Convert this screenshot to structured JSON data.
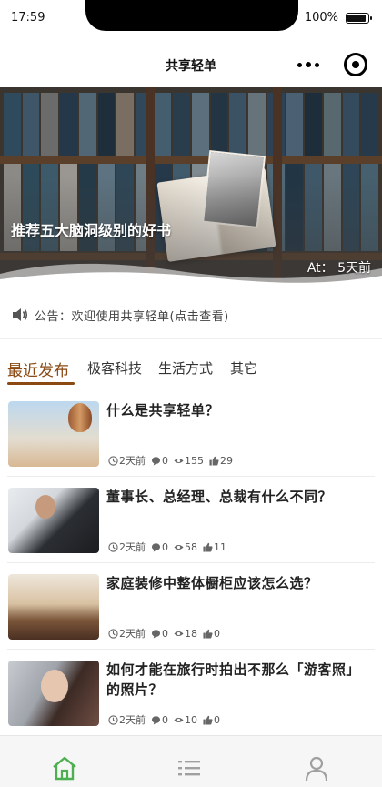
{
  "status_bar": {
    "time": "17:59",
    "battery_text": "100%",
    "battery_level": 1.0
  },
  "nav": {
    "title": "共享轻单",
    "more_icon": "more-dots-icon",
    "target_icon": "target-icon"
  },
  "banner": {
    "title": "推荐五大脑洞级别的好书",
    "meta": "At： 5天前"
  },
  "notice": {
    "icon": "speaker-icon",
    "text": "公告：欢迎使用共享轻单(点击查看)"
  },
  "tabs": [
    {
      "label": "最近发布",
      "active": true
    },
    {
      "label": "极客科技",
      "active": false
    },
    {
      "label": "生活方式",
      "active": false
    },
    {
      "label": "其它",
      "active": false
    }
  ],
  "articles": [
    {
      "title": "什么是共享轻单？",
      "time": "2天前",
      "comments": "0",
      "views": "155",
      "likes": "29"
    },
    {
      "title": "董事长、总经理、总裁有什么不同？",
      "time": "2天前",
      "comments": "0",
      "views": "58",
      "likes": "11"
    },
    {
      "title": "家庭装修中整体橱柜应该怎么选？",
      "time": "2天前",
      "comments": "0",
      "views": "18",
      "likes": "0"
    },
    {
      "title": "如何才能在旅行时拍出不那么「游客照」的照片？",
      "time": "2天前",
      "comments": "0",
      "views": "10",
      "likes": "0"
    }
  ],
  "tabbar": [
    {
      "icon": "home-icon",
      "active": true
    },
    {
      "icon": "list-icon",
      "active": false
    },
    {
      "icon": "user-icon",
      "active": false
    }
  ],
  "colors": {
    "accent": "#8a4a12",
    "tabbar_active": "#4caf50",
    "tabbar_inactive": "#a0a0a0"
  }
}
